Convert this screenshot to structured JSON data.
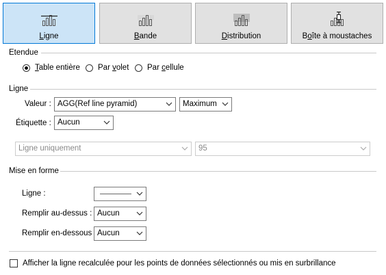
{
  "tabs": [
    {
      "label_pre": "",
      "label_u": "L",
      "label_post": "igne",
      "icon": "line-chart-icon",
      "selected": true
    },
    {
      "label_pre": "",
      "label_u": "B",
      "label_post": "ande",
      "icon": "band-chart-icon",
      "selected": false
    },
    {
      "label_pre": "",
      "label_u": "D",
      "label_post": "istribution",
      "icon": "distribution-chart-icon",
      "selected": false
    },
    {
      "label_pre": "B",
      "label_u": "o",
      "label_post": "îte à moustaches",
      "icon": "box-plot-icon",
      "selected": false
    }
  ],
  "scope": {
    "title": "Etendue",
    "options": [
      {
        "pre": "",
        "u": "T",
        "post": "able entière",
        "selected": true
      },
      {
        "pre": "Par ",
        "u": "v",
        "post": "olet",
        "selected": false
      },
      {
        "pre": "Par ",
        "u": "c",
        "post": "ellule",
        "selected": false
      }
    ]
  },
  "line": {
    "title": "Ligne",
    "value_label": "Valeur :",
    "value_field": "AGG(Ref line pyramid)",
    "aggregation": "Maximum",
    "label_label": "Étiquette :",
    "label_value": "Aucun",
    "mode_value": "Ligne uniquement",
    "percent_value": "95"
  },
  "format": {
    "title": "Mise en forme",
    "line_label": "Ligne :",
    "fill_above_label": "Remplir au-dessus :",
    "fill_above_value": "Aucun",
    "fill_below_label": "Remplir en-dessous :",
    "fill_below_value": "Aucun"
  },
  "recalc": {
    "label": "Afficher la ligne recalculée pour les points de données sélectionnés ou mis en surbrillance",
    "checked": false
  },
  "colors": {
    "selected_tab_bg": "#cce4f7",
    "selected_tab_border": "#0078d7",
    "tab_bg": "#e1e1e1"
  }
}
